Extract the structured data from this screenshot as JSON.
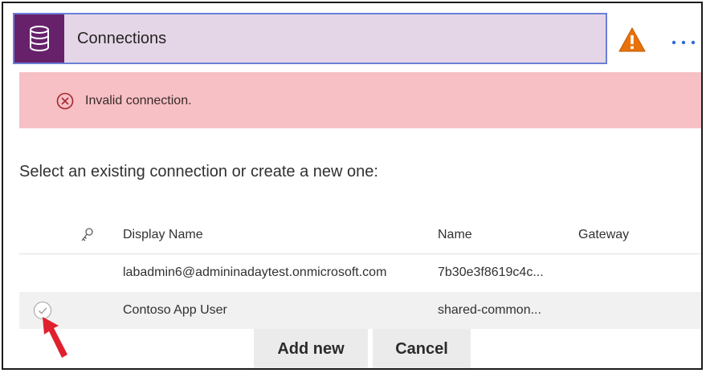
{
  "card": {
    "title": "Connections",
    "icon": "database-icon",
    "warning_icon": "warning-icon",
    "more_label": "···"
  },
  "error": {
    "icon": "error-circle-icon",
    "message": "Invalid connection."
  },
  "prompt": "Select an existing connection or create a new one:",
  "table": {
    "columns": {
      "key_icon": "key-icon",
      "display_name": "Display Name",
      "name": "Name",
      "gateway": "Gateway"
    },
    "rows": [
      {
        "display_name": "labadmin6@admininadaytest.onmicrosoft.com",
        "name": "7b30e3f8619c4c...",
        "gateway": ""
      },
      {
        "display_name": "Contoso App User",
        "name": "shared-common...",
        "gateway": ""
      }
    ]
  },
  "buttons": {
    "add_new": "Add new",
    "cancel": "Cancel"
  },
  "colors": {
    "header_bg": "#e4d6e7",
    "icon_bg": "#67216b",
    "error_bg": "#f6c0c5",
    "warning": "#e8710a",
    "accent": "#2f6bd8",
    "arrow": "#e0202e"
  }
}
